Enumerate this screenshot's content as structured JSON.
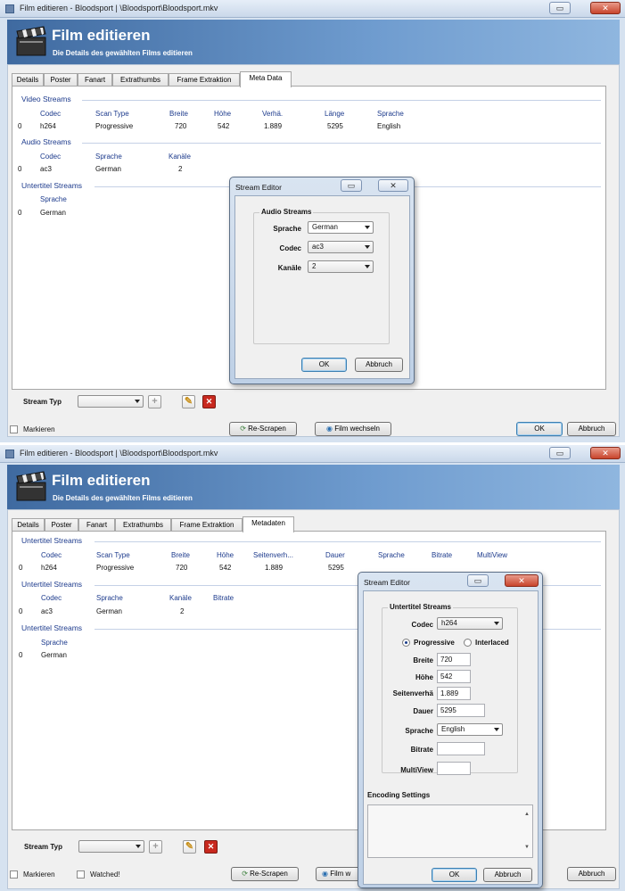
{
  "shot1": {
    "window_title": "Film editieren - Bloodsport | \\Bloodsport\\Bloodsport.mkv",
    "banner_title": "Film editieren",
    "banner_subtitle": "Die Details des gewählten Films editieren",
    "tabs": [
      "Details",
      "Poster",
      "Fanart",
      "Extrathumbs",
      "Frame Extraktion",
      "Meta Data"
    ],
    "active_tab": "Meta Data",
    "video_group": "Video Streams",
    "video_headers": [
      "Codec",
      "Scan Type",
      "Breite",
      "Höhe",
      "Verhä.",
      "Länge",
      "Sprache"
    ],
    "video_row": [
      "0",
      "h264",
      "Progressive",
      "720",
      "542",
      "1.889",
      "5295",
      "English"
    ],
    "audio_group": "Audio Streams",
    "audio_headers": [
      "Codec",
      "Sprache",
      "Kanäle"
    ],
    "audio_row": [
      "0",
      "ac3",
      "German",
      "2"
    ],
    "subtitle_group": "Untertitel Streams",
    "subtitle_headers": [
      "Sprache"
    ],
    "subtitle_row": [
      "0",
      "German"
    ],
    "stream_type_label": "Stream Typ",
    "mark_label": "Markieren",
    "rescrape_label": "Re-Scrapen",
    "change_film_label": "Film wechseln",
    "ok_label": "OK",
    "cancel_label": "Abbruch",
    "dialog": {
      "title": "Stream Editor",
      "group": "Audio Streams",
      "language_label": "Sprache",
      "language_value": "German",
      "codec_label": "Codec",
      "codec_value": "ac3",
      "channels_label": "Kanäle",
      "channels_value": "2",
      "ok": "OK",
      "cancel": "Abbruch"
    }
  },
  "shot2": {
    "window_title": "Film editieren - Bloodsport | \\Bloodsport\\Bloodsport.mkv",
    "banner_title": "Film editieren",
    "banner_subtitle": "Die Details des gewählten Films editieren",
    "tabs": [
      "Details",
      "Poster",
      "Fanart",
      "Extrathumbs",
      "Frame Extraktion",
      "Metadaten"
    ],
    "active_tab": "Metadaten",
    "video_group": "Untertitel Streams",
    "video_headers": [
      "Codec",
      "Scan Type",
      "Breite",
      "Höhe",
      "Seitenverh...",
      "Dauer",
      "Sprache",
      "Bitrate",
      "MultiView"
    ],
    "video_row": [
      "0",
      "h264",
      "Progressive",
      "720",
      "542",
      "1.889",
      "5295"
    ],
    "audio_group": "Untertitel Streams",
    "audio_headers": [
      "Codec",
      "Sprache",
      "Kanäle",
      "Bitrate"
    ],
    "audio_row": [
      "0",
      "ac3",
      "German",
      "2"
    ],
    "subtitle_group": "Untertitel Streams",
    "subtitle_headers": [
      "Sprache"
    ],
    "subtitle_row": [
      "0",
      "German"
    ],
    "stream_type_label": "Stream Typ",
    "mark_label": "Markieren",
    "watched_label": "Watched!",
    "rescrape_label": "Re-Scrapen",
    "change_film_label": "Film w",
    "cancel_label": "Abbruch",
    "dialog": {
      "title": "Stream Editor",
      "group": "Untertitel Streams",
      "codec_label": "Codec",
      "codec_value": "h264",
      "progressive": "Progressive",
      "interlaced": "Interlaced",
      "width_label": "Breite",
      "width_value": "720",
      "height_label": "Höhe",
      "height_value": "542",
      "aspect_label": "Seitenverhä",
      "aspect_value": "1.889",
      "duration_label": "Dauer",
      "duration_value": "5295",
      "language_label": "Sprache",
      "language_value": "English",
      "bitrate_label": "Bitrate",
      "bitrate_value": "",
      "multiview_label": "MultiView",
      "multiview_value": "",
      "encoding_label": "Encoding Settings",
      "ok": "OK",
      "cancel": "Abbruch"
    }
  }
}
